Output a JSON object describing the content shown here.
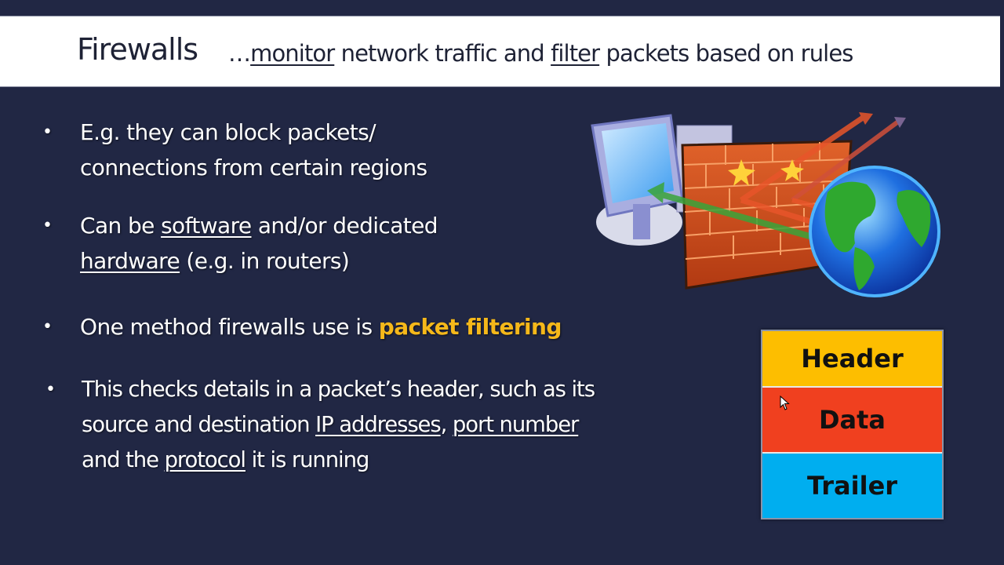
{
  "title": {
    "main": "Firewalls",
    "sub_prefix": "…",
    "sub_word1": "monitor",
    "sub_mid": " network traffic and ",
    "sub_word2": "filter",
    "sub_end": " packets based on rules"
  },
  "bullets": [
    {
      "parts": [
        "E.g. they can block packets/",
        "connections from certain regions"
      ]
    },
    {
      "p1": "Can be ",
      "u1": "software",
      "p2": " and/or dedicated",
      "u2": "hardware",
      "p3": " (e.g. in routers)"
    },
    {
      "p1": "One method firewalls use is ",
      "highlight": "packet filtering"
    },
    {
      "p1": "This checks details in a packet’s header, such as its",
      "p2": "source and destination ",
      "u1": "IP addresses",
      "p3": ", ",
      "u2": "port number",
      "p4": "and the ",
      "u3": "protocol",
      "p5": " it is running"
    }
  ],
  "bullet_glyph": "•",
  "illustration": {
    "icon": "firewall-computer-globe-illustration"
  },
  "packet": {
    "segments": [
      {
        "label": "Header",
        "color": "#fdbe00"
      },
      {
        "label": "Data",
        "color": "#f0401f"
      },
      {
        "label": "Trailer",
        "color": "#00aeef"
      }
    ]
  },
  "colors": {
    "background": "#212744",
    "title_bar": "#ffffff",
    "highlight": "#f5b81a"
  }
}
